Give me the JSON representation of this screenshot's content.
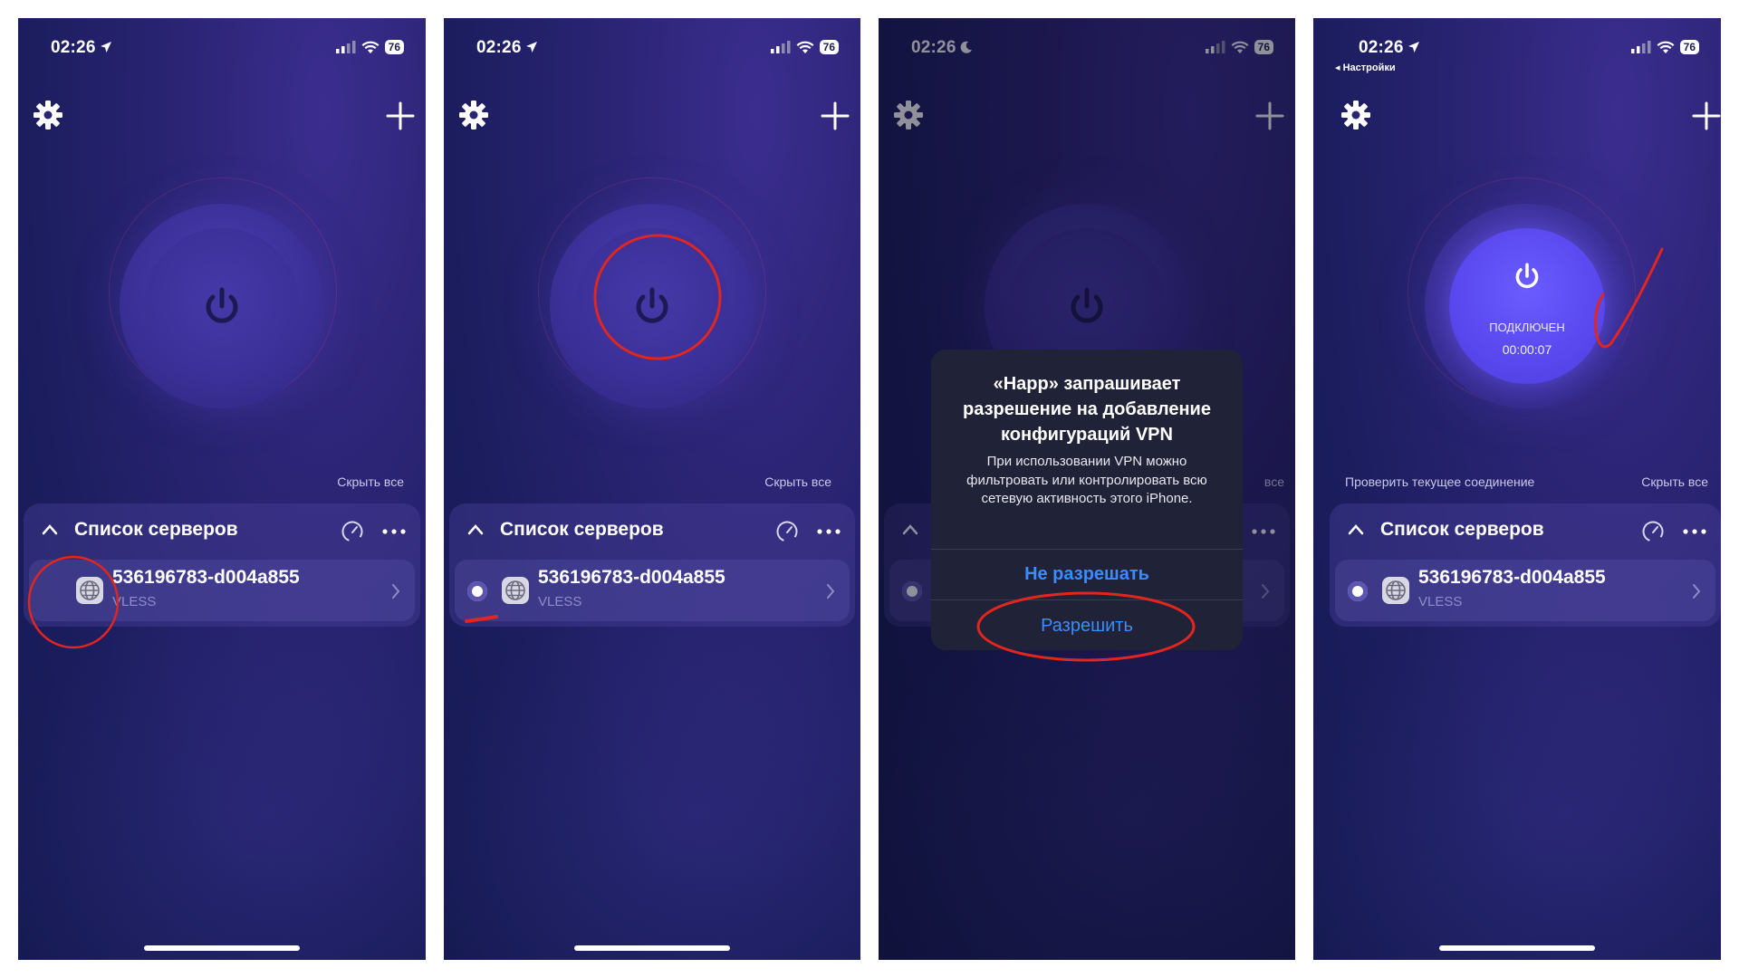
{
  "phones": [
    {
      "time": "02:26",
      "battery": "76",
      "hide_all": "Скрыть все",
      "server_list": {
        "title": "Список серверов",
        "item": {
          "name": "536196783-d004a855",
          "protocol": "VLESS"
        }
      }
    },
    {
      "time": "02:26",
      "battery": "76",
      "hide_all": "Скрыть все",
      "server_list": {
        "title": "Список серверов",
        "item": {
          "name": "536196783-d004a855",
          "protocol": "VLESS"
        }
      }
    },
    {
      "time": "02:26",
      "battery": "76",
      "hide_all_partial": "все",
      "alert": {
        "title": "«Happ» запрашивает разрешение на добавление конфигураций VPN",
        "message": "При использовании VPN можно фильтровать или контролировать всю сетевую активность этого iPhone.",
        "deny_label": "Не разрешать",
        "allow_label": "Разрешить"
      }
    },
    {
      "time": "02:26",
      "back_label": "◂ Настройки",
      "battery": "76",
      "status_label": "ПОДКЛЮЧЕН",
      "timer": "00:00:07",
      "check_connection": "Проверить текущее соединение",
      "hide_all": "Скрыть все",
      "server_list": {
        "title": "Список серверов",
        "item": {
          "name": "536196783-d004a855",
          "protocol": "VLESS"
        }
      }
    }
  ],
  "colors": {
    "accent_blue": "#3b8cff",
    "annotation_red": "#e0261e",
    "connected_button": "#5848ee"
  }
}
